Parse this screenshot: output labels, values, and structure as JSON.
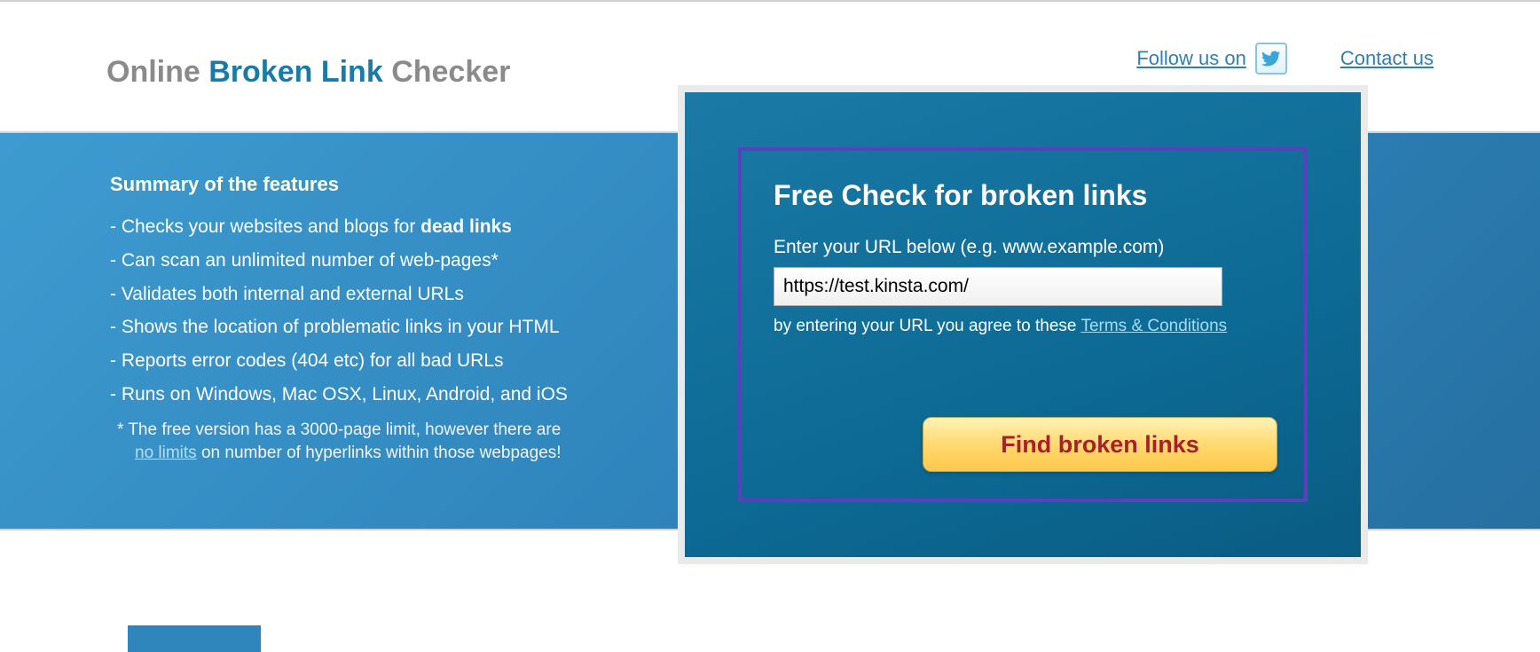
{
  "header": {
    "logo_part1": "Online",
    "logo_part2": "Broken Link",
    "logo_part3": "Checker",
    "follow_label": "Follow us on",
    "contact_label": "Contact us"
  },
  "features": {
    "title": "Summary of the features",
    "items": [
      {
        "prefix": "- Checks your websites and blogs for ",
        "bold": "dead links"
      },
      {
        "text": "- Can scan an unlimited number of web-pages*"
      },
      {
        "text": "- Validates both internal and external URLs"
      },
      {
        "text": "- Shows the location of problematic links in your HTML"
      },
      {
        "text": "- Reports error codes (404 etc) for all bad URLs"
      },
      {
        "text": "- Runs on Windows, Mac OSX, Linux, Android, and iOS"
      }
    ],
    "note_line1": "*  The free version has a 3000-page limit, however there are",
    "no_limits_label": "no limits",
    "note_line2_rest": " on number of hyperlinks within those webpages!"
  },
  "panel": {
    "title": "Free Check for broken links",
    "label": "Enter your URL below (e.g. www.example.com)",
    "url_value": "https://test.kinsta.com/",
    "terms_prefix": "by entering your URL you agree to these ",
    "terms_link": "Terms & Conditions",
    "button_label": "Find broken links"
  }
}
